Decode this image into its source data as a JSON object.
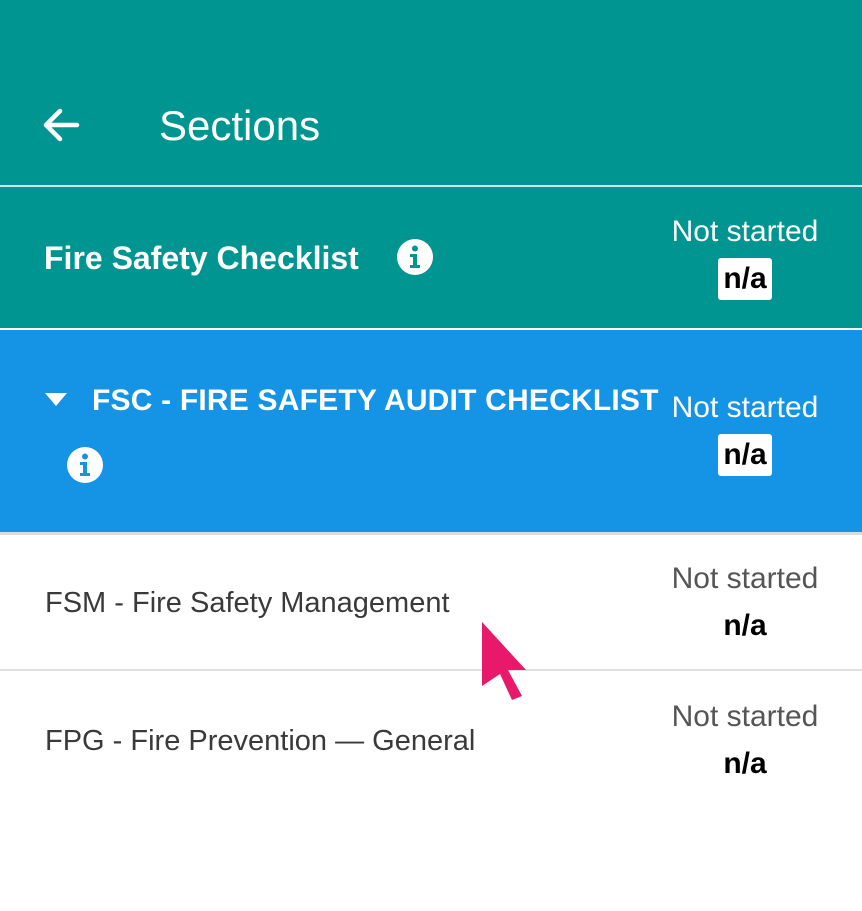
{
  "appbar": {
    "title": "Sections",
    "back_icon": "arrow-left-icon"
  },
  "checklist": {
    "title": "Fire Safety Checklist",
    "status": "Not started",
    "score": "n/a"
  },
  "section": {
    "title": "FSC - FIRE SAFETY AUDIT CHECKLIST",
    "status": "Not started",
    "score": "n/a"
  },
  "items": [
    {
      "title": "FSM - Fire Safety Management",
      "status": "Not started",
      "score": "n/a"
    },
    {
      "title": "FPG - Fire Prevention — General",
      "status": "Not started",
      "score": "n/a"
    }
  ],
  "colors": {
    "appbar": "#009590",
    "section_header": "#1593e5",
    "cursor": "#e8196b"
  }
}
